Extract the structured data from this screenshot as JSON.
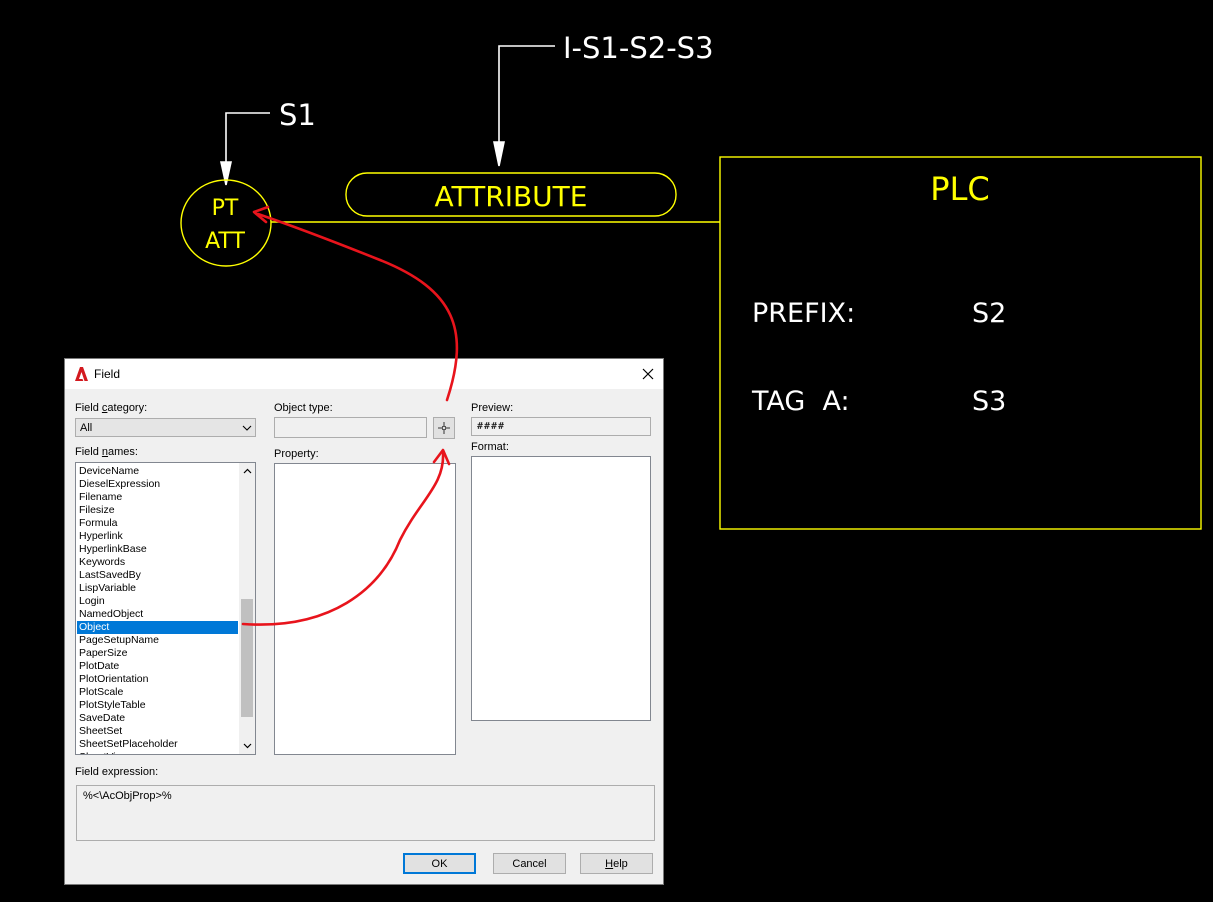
{
  "cad": {
    "leader1_label": "S1",
    "leader2_label": "I-S1-S2-S3",
    "balloon_line1": "PT",
    "balloon_line2": "ATT",
    "attribute_label": "ATTRIBUTE",
    "plc_title": "PLC",
    "prefix_label": "PREFIX:",
    "prefix_value": "S2",
    "tag_label": "TAG  A:",
    "tag_value": "S3",
    "colors": {
      "yellow": "#ffff00",
      "white": "#ffffff",
      "annotation_red": "#e8141c"
    }
  },
  "dialog": {
    "title": "Field",
    "app_icon": "autocad-icon",
    "close_icon": "close-icon",
    "field_category_label_pre": "Field ",
    "field_category_label_ul": "c",
    "field_category_label_post": "ategory:",
    "field_category_value": "All",
    "field_names_label_pre": "Field ",
    "field_names_label_ul": "n",
    "field_names_label_post": "ames:",
    "field_names": [
      "DeviceName",
      "DieselExpression",
      "Filename",
      "Filesize",
      "Formula",
      "Hyperlink",
      "HyperlinkBase",
      "Keywords",
      "LastSavedBy",
      "LispVariable",
      "Login",
      "NamedObject",
      "Object",
      "PageSetupName",
      "PaperSize",
      "PlotDate",
      "PlotOrientation",
      "PlotScale",
      "PlotStyleTable",
      "SaveDate",
      "SheetSet",
      "SheetSetPlaceholder",
      "SheetView"
    ],
    "selected_field": "Object",
    "object_type_label": "Object type:",
    "object_type_value": "",
    "property_label": "Property:",
    "preview_label": "Preview:",
    "preview_value": "####",
    "format_label": "Format:",
    "field_expression_label": "Field expression:",
    "field_expression_value": "%<\\AcObjProp>%",
    "ok_label": "OK",
    "cancel_label": "Cancel",
    "help_label_ul": "H",
    "help_label_post": "elp"
  }
}
